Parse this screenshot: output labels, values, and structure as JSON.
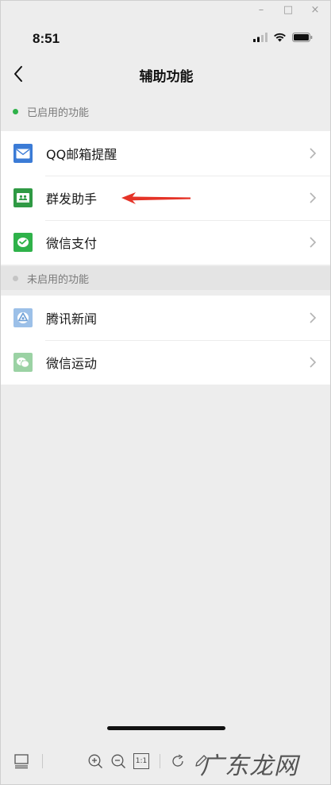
{
  "window_controls": {
    "minimize": "–",
    "maximize": "□",
    "close": "×"
  },
  "status_bar": {
    "time": "8:51"
  },
  "nav": {
    "title": "辅助功能"
  },
  "sections": [
    {
      "label": "已启用的功能",
      "dot_color": "#2fb24a",
      "items": [
        {
          "label": "QQ邮箱提醒",
          "icon": "mail-icon",
          "icon_color": "#3b7bd6"
        },
        {
          "label": "群发助手",
          "icon": "group-message-icon",
          "icon_color": "#2f9a44"
        },
        {
          "label": "微信支付",
          "icon": "wechat-pay-icon",
          "icon_color": "#2fb24a"
        }
      ]
    },
    {
      "label": "未启用的功能",
      "dot_color": "#c4c4c4",
      "items": [
        {
          "label": "腾讯新闻",
          "icon": "tencent-news-icon",
          "icon_color": "#9cc0e8"
        },
        {
          "label": "微信运动",
          "icon": "wechat-sport-icon",
          "icon_color": "#9bd2a4"
        }
      ]
    }
  ],
  "annotation": {
    "color": "#e53327"
  },
  "toolbar": {
    "tools": [
      "layout-icon",
      "zoom-in-icon",
      "zoom-out-icon",
      "actual-size-icon",
      "rotate-icon",
      "pen-icon"
    ],
    "actual_size_label": "1:1"
  },
  "watermark": {
    "text": "广东龙网"
  }
}
